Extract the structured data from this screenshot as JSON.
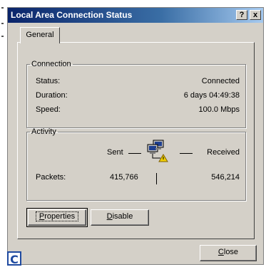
{
  "window": {
    "title": "Local Area Connection Status",
    "help_button": "?",
    "close_button": "x"
  },
  "tabs": [
    {
      "label": "General"
    }
  ],
  "connection": {
    "group_label": "Connection",
    "rows": [
      {
        "label": "Status:",
        "value": "Connected"
      },
      {
        "label": "Duration:",
        "value": "6 days 04:49:38"
      },
      {
        "label": "Speed:",
        "value": "100.0 Mbps"
      }
    ]
  },
  "activity": {
    "group_label": "Activity",
    "sent_label": "Sent",
    "received_label": "Received",
    "packets_label": "Packets:",
    "packets_sent": "415,766",
    "packets_received": "546,214"
  },
  "buttons": {
    "properties": {
      "first": "P",
      "rest": "roperties"
    },
    "disable": {
      "first": "D",
      "rest": "isable"
    },
    "close": {
      "first": "C",
      "rest": "lose"
    }
  },
  "badge": "C",
  "icons": {
    "network": "network-status-icon"
  },
  "colors": {
    "title_start": "#0a246a",
    "title_end": "#a6caf0",
    "face": "#d4d0c8"
  }
}
